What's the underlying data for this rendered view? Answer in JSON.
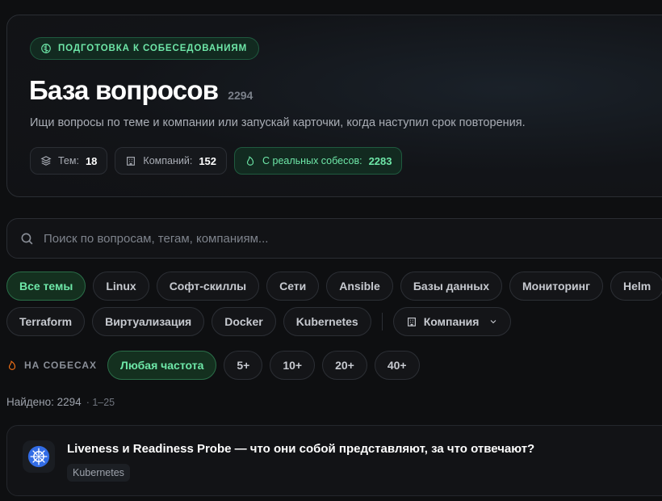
{
  "hero": {
    "badge": "ПОДГОТОВКА К СОБЕСЕДОВАНИЯМ",
    "title": "База вопросов",
    "count": "2294",
    "subtitle": "Ищи вопросы по теме и компании или запускай карточки, когда наступил срок повторения.",
    "stats": [
      {
        "label": "Тем:",
        "value": "18",
        "icon": "layers-icon"
      },
      {
        "label": "Компаний:",
        "value": "152",
        "icon": "building-icon"
      },
      {
        "label": "С реальных собесов:",
        "value": "2283",
        "icon": "flame-icon"
      }
    ]
  },
  "search": {
    "placeholder": "Поиск по вопросам, тегам, компаниям..."
  },
  "topics": {
    "row1": [
      "Все темы",
      "Linux",
      "Софт-скиллы",
      "Сети",
      "Ansible",
      "Базы данных",
      "Мониторинг",
      "Helm"
    ],
    "row2": [
      "Terraform",
      "Виртуализация",
      "Docker",
      "Kubernetes"
    ],
    "company": "Компания"
  },
  "frequency": {
    "label": "НА СОБЕСАХ",
    "options": [
      "Любая частота",
      "5+",
      "10+",
      "20+",
      "40+"
    ]
  },
  "results": {
    "found": "Найдено: 2294",
    "range": "· 1–25"
  },
  "card": {
    "title": "Liveness и Readiness Probe — что они собой представляют, за что отвечают?",
    "tag": "Kubernetes",
    "icon": "kubernetes-icon"
  },
  "colors": {
    "accent": "#6ee7a8",
    "background": "#0e0f11",
    "kubernetes": "#326ce5"
  }
}
